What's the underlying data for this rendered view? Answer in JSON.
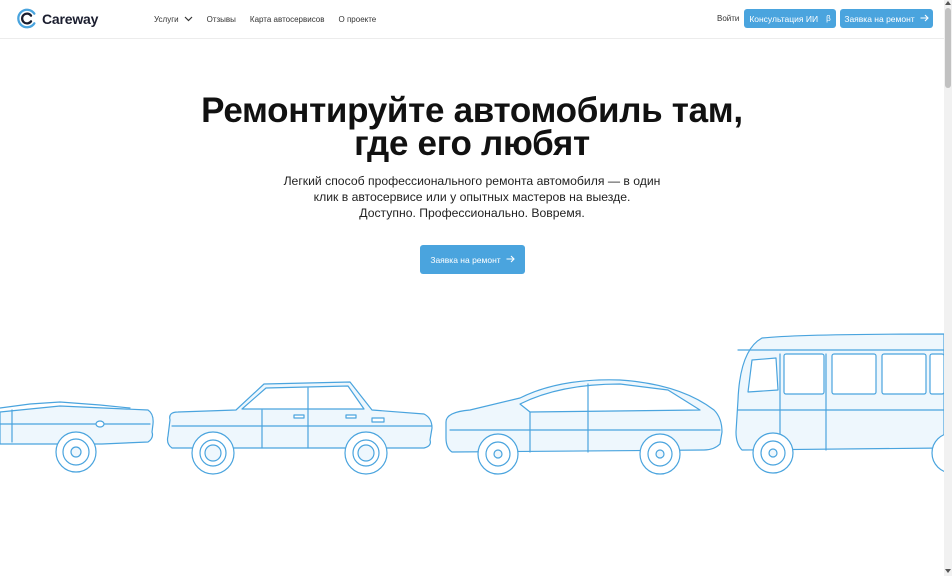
{
  "header": {
    "logo_text": "Careway",
    "nav": [
      {
        "label": "Услуги",
        "has_dropdown": true
      },
      {
        "label": "Отзывы"
      },
      {
        "label": "Карта автосервисов"
      },
      {
        "label": "О проекте"
      }
    ],
    "login_label": "Войти",
    "ai_button_label": "Консультация ИИ",
    "ai_button_badge": "β",
    "request_button_label": "Заявка на ремонт"
  },
  "hero": {
    "title_line1": "Ремонтируйте автомобиль там,",
    "title_line2": "где его любят",
    "subtitle_line1": "Легкий способ профессионального ремонта автомобиля — в один",
    "subtitle_line2": "клик в автосервисе или у опытных мастеров на выезде.",
    "subtitle_line3": "Доступно. Профессионально. Вовремя.",
    "cta_label": "Заявка на ремонт"
  },
  "illustration": {
    "vehicles": [
      "convertible",
      "classic-sedan",
      "modern-sedan",
      "minibus"
    ],
    "line_color": "#4aa4de",
    "fill_color": "#eef7fd"
  },
  "colors": {
    "accent": "#4aa4de",
    "text": "#111111"
  }
}
